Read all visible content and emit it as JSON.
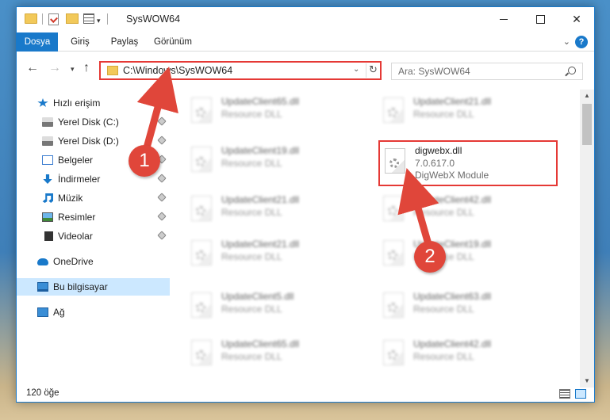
{
  "window": {
    "title": "SysWOW64",
    "controls": {
      "minimize": "minimize-icon",
      "maximize": "maximize-icon",
      "close": "✕"
    }
  },
  "ribbon": {
    "tabs": [
      {
        "label": "Dosya"
      },
      {
        "label": "Giriş"
      },
      {
        "label": "Paylaş"
      },
      {
        "label": "Görünüm"
      }
    ],
    "help": "?"
  },
  "address": {
    "path": "C:\\Windows\\SysWOW64",
    "search_placeholder": "Ara: SysWOW64"
  },
  "sidebar": {
    "items": [
      {
        "label": "Hızlı erişim",
        "icon": "star-icon"
      },
      {
        "label": "Yerel Disk (C:)",
        "icon": "disk-icon"
      },
      {
        "label": "Yerel Disk (D:)",
        "icon": "disk-icon"
      },
      {
        "label": "Belgeler",
        "icon": "documents-icon"
      },
      {
        "label": "İndirmeler",
        "icon": "download-icon"
      },
      {
        "label": "Müzik",
        "icon": "music-icon"
      },
      {
        "label": "Resimler",
        "icon": "pictures-icon"
      },
      {
        "label": "Videolar",
        "icon": "videos-icon"
      },
      {
        "label": "OneDrive",
        "icon": "cloud-icon"
      },
      {
        "label": "Bu bilgisayar",
        "icon": "computer-icon"
      },
      {
        "label": "Ağ",
        "icon": "network-icon"
      }
    ]
  },
  "files": {
    "left": [
      {
        "name": "UpdateClient65.dll",
        "type": "Resource DLL"
      },
      {
        "name": "UpdateClient19.dll",
        "type": "Resource DLL"
      },
      {
        "name": "UpdateClient21.dll",
        "type": "Resource DLL"
      },
      {
        "name": "UpdateClient21.dll",
        "type": "Resource DLL"
      },
      {
        "name": "UpdateClient5.dll",
        "type": "Resource DLL"
      },
      {
        "name": "UpdateClient65.dll",
        "type": "Resource DLL"
      }
    ],
    "right": [
      {
        "name": "UpdateClient21.dll",
        "type": "Resource DLL"
      },
      {
        "name": "UpdateClient42.dll",
        "type": "Resource DLL"
      },
      {
        "name": "UpdateClient19.dll",
        "type": "Resource DLL"
      },
      {
        "name": "UpdateClient63.dll",
        "type": "Resource DLL"
      },
      {
        "name": "UpdateClient42.dll",
        "type": "Resource DLL"
      }
    ],
    "highlighted": {
      "name": "digwebx.dll",
      "version": "7.0.617.0",
      "description": "DigWebX Module"
    }
  },
  "status": {
    "item_count": "120 öğe"
  },
  "annotations": {
    "step1": "1",
    "step2": "2",
    "accent": "#e0463a"
  }
}
